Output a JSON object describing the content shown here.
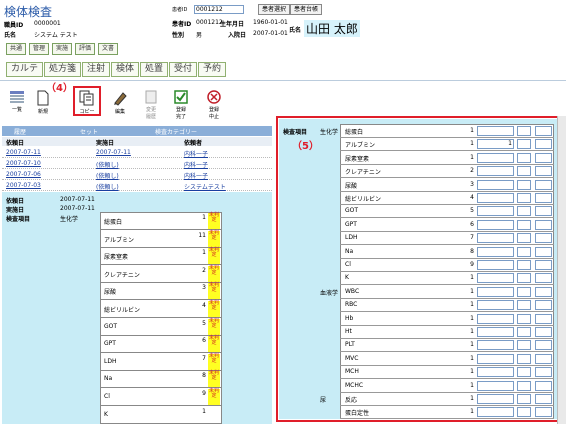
{
  "title": "検体検査",
  "header": {
    "staff_id_label": "職員ID",
    "staff_id": "0000001",
    "staff_name_label": "氏名",
    "staff_name": "システム テスト",
    "patient_id_field_label": "患者ID",
    "patient_id_field_value": "0001212",
    "patient_select_button": "患者選択",
    "patient_ledger_button": "患者台帳",
    "patient_id_label": "患者ID",
    "patient_id": "0001212",
    "birthdate_label": "生年月日",
    "birthdate": "1960-01-01",
    "sex_label": "性別",
    "sex": "男",
    "admission_label": "入院日",
    "admission": "2007-01-01",
    "name_label": "氏名",
    "patient_name": "山田 太郎"
  },
  "nav_buttons": [
    "共通",
    "管理",
    "実施",
    "評価",
    "文書"
  ],
  "tabs": [
    "カルテ",
    "処方箋",
    "注射",
    "検体",
    "処置",
    "受付",
    "予約"
  ],
  "toolbar": {
    "list": "一覧",
    "new": "新規",
    "copy": "コピー",
    "edit": "編集",
    "change_history": "変更\n履歴",
    "register_done": "登録\n完了",
    "register_stop": "登録\n中止"
  },
  "annotations": {
    "four": "（4）",
    "five": "（5）"
  },
  "left_tabs": {
    "history": "履歴",
    "set": "セット",
    "category": "検査カテゴリー"
  },
  "history": {
    "headers": [
      "依頼日",
      "実施日",
      "依頼者"
    ],
    "rows": [
      [
        "2007-07-11",
        "2007-07-11",
        "内科一子"
      ],
      [
        "2007-07-10",
        "(依頼し)",
        "内科一子"
      ],
      [
        "2007-07-06",
        "(依頼し)",
        "内科一子"
      ],
      [
        "2007-07-03",
        "(依頼し)",
        "システムテスト"
      ]
    ]
  },
  "detail": {
    "request_date_label": "依頼日",
    "request_date": "2007-07-11",
    "done_date_label": "実施日",
    "done_date": "2007-07-11",
    "items_label": "検査項目",
    "category": "生化学",
    "items": [
      {
        "name": "総蛋白",
        "value": "1",
        "status": "未判定"
      },
      {
        "name": "アルブミン",
        "value": "11",
        "status": "未判定"
      },
      {
        "name": "尿素窒素",
        "value": "1",
        "status": "未判定"
      },
      {
        "name": "クレアチニン",
        "value": "2",
        "status": "未判定"
      },
      {
        "name": "尿酸",
        "value": "3",
        "status": "未判定"
      },
      {
        "name": "総ビリルビン",
        "value": "4",
        "status": "未判定"
      },
      {
        "name": "GOT",
        "value": "5",
        "status": "未判定"
      },
      {
        "name": "GPT",
        "value": "6",
        "status": "未判定"
      },
      {
        "name": "LDH",
        "value": "7",
        "status": "未判定"
      },
      {
        "name": "Na",
        "value": "8",
        "status": "未判定"
      },
      {
        "name": "Cl",
        "value": "9",
        "status": "未判定"
      },
      {
        "name": "K",
        "value": "1",
        "status": ""
      }
    ]
  },
  "right_panel": {
    "items_label": "検査項目",
    "rows": [
      {
        "cat": "生化学",
        "name": "総蛋白",
        "num": "1",
        "extra": ""
      },
      {
        "cat": "",
        "name": "アルブミン",
        "num": "1",
        "extra": "1"
      },
      {
        "cat": "",
        "name": "尿素窒素",
        "num": "1",
        "extra": ""
      },
      {
        "cat": "",
        "name": "クレアチニン",
        "num": "2",
        "extra": ""
      },
      {
        "cat": "",
        "name": "尿酸",
        "num": "3",
        "extra": ""
      },
      {
        "cat": "",
        "name": "総ビリルビン",
        "num": "4",
        "extra": ""
      },
      {
        "cat": "",
        "name": "GOT",
        "num": "5",
        "extra": ""
      },
      {
        "cat": "",
        "name": "GPT",
        "num": "6",
        "extra": ""
      },
      {
        "cat": "",
        "name": "LDH",
        "num": "7",
        "extra": ""
      },
      {
        "cat": "",
        "name": "Na",
        "num": "8",
        "extra": ""
      },
      {
        "cat": "",
        "name": "Cl",
        "num": "9",
        "extra": ""
      },
      {
        "cat": "",
        "name": "K",
        "num": "1",
        "extra": ""
      },
      {
        "cat": "血液学",
        "name": "WBC",
        "num": "1",
        "extra": ""
      },
      {
        "cat": "",
        "name": "RBC",
        "num": "1",
        "extra": ""
      },
      {
        "cat": "",
        "name": "Hb",
        "num": "1",
        "extra": ""
      },
      {
        "cat": "",
        "name": "Ht",
        "num": "1",
        "extra": ""
      },
      {
        "cat": "",
        "name": "PLT",
        "num": "1",
        "extra": ""
      },
      {
        "cat": "",
        "name": "MVC",
        "num": "1",
        "extra": ""
      },
      {
        "cat": "",
        "name": "MCH",
        "num": "1",
        "extra": ""
      },
      {
        "cat": "",
        "name": "MCHC",
        "num": "1",
        "extra": ""
      },
      {
        "cat": "尿",
        "name": "反応",
        "num": "1",
        "extra": ""
      },
      {
        "cat": "",
        "name": "蛋白定性",
        "num": "1",
        "extra": ""
      }
    ]
  }
}
